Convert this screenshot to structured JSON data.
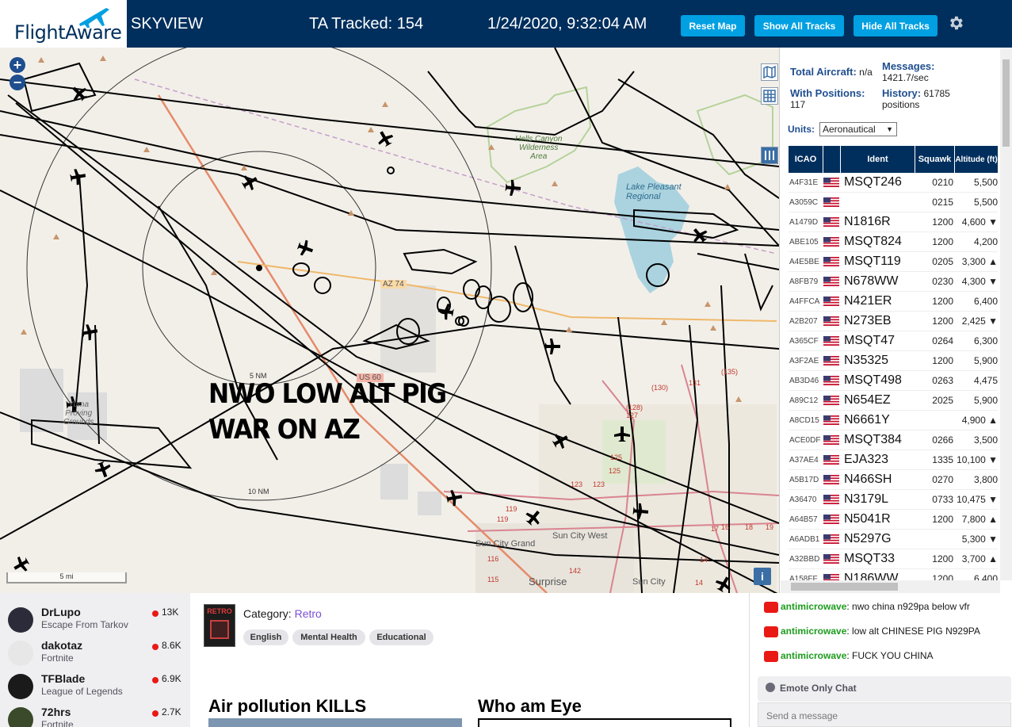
{
  "header": {
    "logo_text": "FlightAware",
    "app_name": "SKYVIEW",
    "tracked": "TA Tracked: 154",
    "datetime": "1/24/2020, 9:32:04 AM",
    "buttons": {
      "reset_map": "Reset Map",
      "show_all": "Show All Tracks",
      "hide_all": "Hide All Tracks"
    },
    "accent_color": "#00a0e2",
    "bg_color": "#002f5d"
  },
  "map": {
    "zoom_in": "+",
    "zoom_out": "−",
    "overlay_line1": "NWO LOW ALT PIG",
    "overlay_line2": "WAR ON AZ",
    "labels": {
      "hells_canyon": "Hells Canyon\nWilderness\nArea",
      "lake_pleasant": "Lake Pleasant\nRegional",
      "proving": "Yuma\nProving\nGrounds",
      "az74": "AZ 74",
      "us60": "US 60",
      "nm5": "5 NM",
      "nm10": "10 NM",
      "sun_city_grand": "Sun City Grand",
      "sun_city_west": "Sun City West",
      "surprise": "Surprise",
      "sun_city": "Sun City",
      "r130": "(130)",
      "r131": "131",
      "r135": "(135)",
      "r128": "(128)",
      "r127": "127",
      "r125a": "125",
      "r125b": "125",
      "r123a": "123",
      "r123b": "123",
      "r119a": "119",
      "r119b": "119",
      "r116": "116",
      "r115": "115",
      "r142": "142",
      "r14a": "14",
      "r14b": "14",
      "r16": "16",
      "r17": "17",
      "r18": "18",
      "r19": "19",
      "scale": "5 mi"
    },
    "info": "i"
  },
  "panel": {
    "total_aircraft_label": "Total Aircraft:",
    "total_aircraft_value": "n/a",
    "messages_label": "Messages:",
    "messages_value": "1421.7/sec",
    "with_positions_label": "With Positions:",
    "with_positions_value": "117",
    "history_label": "History:",
    "history_value": "61785 positions",
    "units_label": "Units:",
    "units_value": "Aeronautical",
    "columns": {
      "icao": "ICAO",
      "flag": "",
      "ident": "Ident",
      "squawk": "Squawk",
      "altitude": "Altitude (ft)"
    },
    "rows": [
      {
        "icao": "A4F31E",
        "ident": "MSQT246",
        "squawk": "0210",
        "alt": "5,500"
      },
      {
        "icao": "A3059C",
        "ident": "",
        "squawk": "0215",
        "alt": "5,500"
      },
      {
        "icao": "A1479D",
        "ident": "N1816R",
        "squawk": "1200",
        "alt": "4,600 ▼"
      },
      {
        "icao": "ABE105",
        "ident": "MSQT824",
        "squawk": "1200",
        "alt": "4,200"
      },
      {
        "icao": "A4E5BE",
        "ident": "MSQT119",
        "squawk": "0205",
        "alt": "3,300 ▲"
      },
      {
        "icao": "A8FB79",
        "ident": "N678WW",
        "squawk": "0230",
        "alt": "4,300 ▼"
      },
      {
        "icao": "A4FFCA",
        "ident": "N421ER",
        "squawk": "1200",
        "alt": "6,400"
      },
      {
        "icao": "A2B207",
        "ident": "N273EB",
        "squawk": "1200",
        "alt": "2,425 ▼"
      },
      {
        "icao": "A365CF",
        "ident": "MSQT47",
        "squawk": "0264",
        "alt": "6,300"
      },
      {
        "icao": "A3F2AE",
        "ident": "N35325",
        "squawk": "1200",
        "alt": "5,900"
      },
      {
        "icao": "AB3D46",
        "ident": "MSQT498",
        "squawk": "0263",
        "alt": "4,475"
      },
      {
        "icao": "A89C12",
        "ident": "N654EZ",
        "squawk": "2025",
        "alt": "5,900"
      },
      {
        "icao": "A8CD15",
        "ident": "N6661Y",
        "squawk": "",
        "alt": "4,900 ▲"
      },
      {
        "icao": "ACE0DF",
        "ident": "MSQT384",
        "squawk": "0266",
        "alt": "3,500"
      },
      {
        "icao": "A37AE4",
        "ident": "EJA323",
        "squawk": "1335",
        "alt": "10,100 ▼"
      },
      {
        "icao": "A5B17D",
        "ident": "N466SH",
        "squawk": "0270",
        "alt": "3,800"
      },
      {
        "icao": "A36470",
        "ident": "N3179L",
        "squawk": "0733",
        "alt": "10,475 ▼"
      },
      {
        "icao": "A64B57",
        "ident": "N5041R",
        "squawk": "1200",
        "alt": "7,800 ▲"
      },
      {
        "icao": "A6ADB1",
        "ident": "N5297G",
        "squawk": "",
        "alt": "5,300 ▼"
      },
      {
        "icao": "A32BBD",
        "ident": "MSQT33",
        "squawk": "1200",
        "alt": "3,700 ▲"
      },
      {
        "icao": "A158FF",
        "ident": "N186WW",
        "squawk": "1200",
        "alt": "6,400"
      }
    ]
  },
  "channels": [
    {
      "name": "DrLupo",
      "game": "Escape From Tarkov",
      "viewers": "13K",
      "color": "#2b2b3a"
    },
    {
      "name": "dakotaz",
      "game": "Fortnite",
      "viewers": "8.6K",
      "color": "#e7e7e7"
    },
    {
      "name": "TFBlade",
      "game": "League of Legends",
      "viewers": "6.9K",
      "color": "#1a1a1a"
    },
    {
      "name": "72hrs",
      "game": "Fortnite",
      "viewers": "2.7K",
      "color": "#3a4a2a"
    }
  ],
  "stream": {
    "category_label": "Category:",
    "category": "Retro",
    "art_text": "RETRO",
    "tags": [
      "English",
      "Mental Health",
      "Educational"
    ],
    "panel1_title": "Air pollution KILLS",
    "panel2_title": "Who am Eye"
  },
  "chat": {
    "messages": [
      {
        "user": "antimicrowave",
        "text": "nwo china n929pa below vfr"
      },
      {
        "user": "antimicrowave",
        "text": "low alt CHINESE PIG N929PA"
      },
      {
        "user": "antimicrowave",
        "text": "FUCK YOU CHINA"
      }
    ],
    "emote_only": "Emote Only Chat",
    "send_placeholder": "Send a message"
  }
}
